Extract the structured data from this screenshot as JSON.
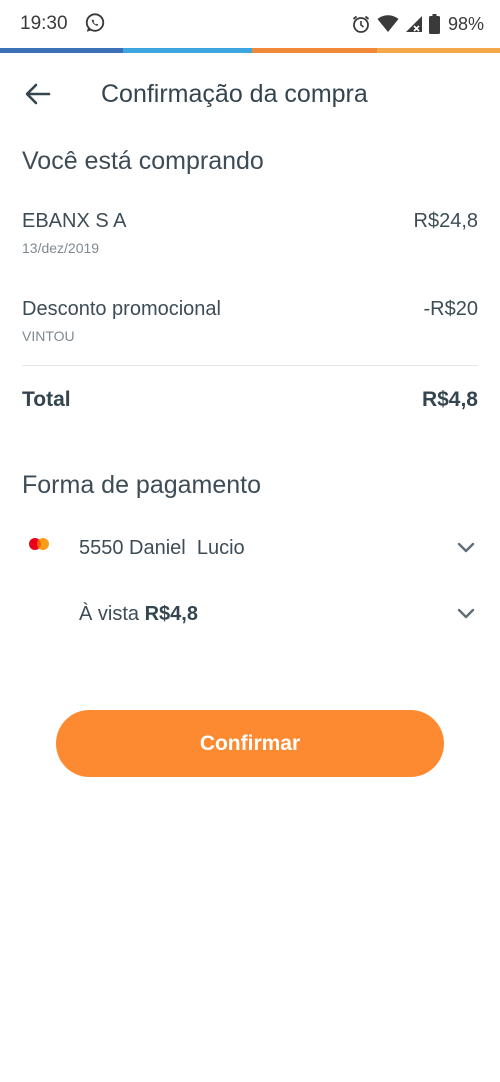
{
  "status_bar": {
    "time": "19:30",
    "battery": "98%",
    "icons": [
      "whatsapp-icon",
      "alarm-icon",
      "wifi-icon",
      "signal-icon",
      "battery-icon"
    ]
  },
  "colors": {
    "accent": "#fd8a31",
    "strip": [
      "#3b6fb6",
      "#3da5e0",
      "#f08a3a",
      "#f5a84a"
    ],
    "text": "#3d4c56"
  },
  "header": {
    "title": "Confirmação da compra",
    "back_icon": "arrow-left-icon"
  },
  "purchase": {
    "section_title": "Você está comprando",
    "items": [
      {
        "name": "EBANX S A",
        "sub": "13/dez/2019",
        "value": "R$24,8"
      },
      {
        "name": "Desconto promocional",
        "sub": "VINTOU",
        "value": "-R$20"
      }
    ],
    "total_label": "Total",
    "total_value": "R$4,8"
  },
  "payment": {
    "section_title": "Forma de pagamento",
    "card_icon": "mastercard-icon",
    "card_text": "5550 Daniel  Lucio",
    "installment_prefix": "À vista ",
    "installment_value": "R$4,8"
  },
  "confirm_label": "Confirmar"
}
